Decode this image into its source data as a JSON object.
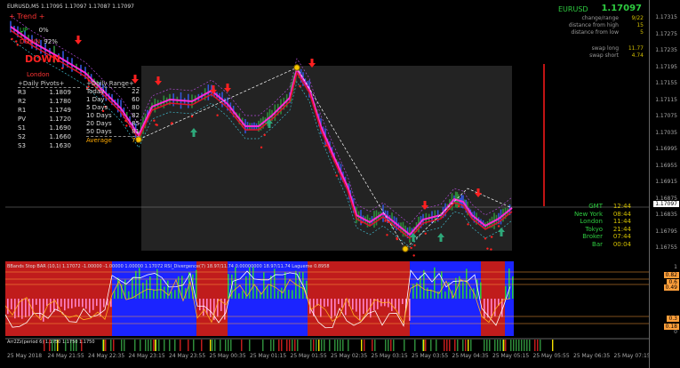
{
  "header": {
    "symbol_line": "EURUSD,M5  1.17095 1.17097 1.17087 1.17097"
  },
  "trend": {
    "title": "Trend",
    "up_label": "UP",
    "up_val": "0%",
    "down_label": "DOWN",
    "down_val": "92%",
    "direction": "DOWN",
    "session": "London"
  },
  "pivots": {
    "title": "+Daily Pivots+",
    "rows": [
      {
        "k": "R3",
        "v": "1.1809"
      },
      {
        "k": "R2",
        "v": "1.1780"
      },
      {
        "k": "R1",
        "v": "1.1749"
      },
      {
        "k": "PV",
        "v": "1.1720"
      },
      {
        "k": "S1",
        "v": "1.1690"
      },
      {
        "k": "S2",
        "v": "1.1660"
      },
      {
        "k": "S3",
        "v": "1.1630"
      }
    ]
  },
  "range": {
    "title": "+Daily Range+",
    "rows": [
      {
        "k": "Today",
        "v": "22"
      },
      {
        "k": "1 Day",
        "v": "60"
      },
      {
        "k": "5 Days",
        "v": "80"
      },
      {
        "k": "10 Days",
        "v": "82"
      },
      {
        "k": "20 Days",
        "v": "85"
      },
      {
        "k": "50 Days",
        "v": "81"
      },
      {
        "k": "Average",
        "v": "77"
      }
    ]
  },
  "info": {
    "symbol": "EURUSD",
    "price": "1.17097",
    "rows": [
      {
        "k": "change/range",
        "v": "9/22"
      },
      {
        "k": "distance from high",
        "v": "15"
      },
      {
        "k": "distance from low",
        "v": "5"
      },
      {
        "k": "swap long",
        "v": "11.77"
      },
      {
        "k": "swap short",
        "v": "4.74"
      }
    ]
  },
  "clocks": [
    {
      "k": "GMT",
      "v": "12:44"
    },
    {
      "k": "New York",
      "v": "08:44"
    },
    {
      "k": "London",
      "v": "11:44"
    },
    {
      "k": "Tokyo",
      "v": "21:44"
    },
    {
      "k": "Broker",
      "v": "07:44"
    },
    {
      "k": "Bar",
      "v": "00:04"
    }
  ],
  "osc_header": "BBands Stop BAR (10,1) 1.17072 -1.00000 -1.00000 1.00000 1.17072  RSI_Divergence(7) 18.97/11.74 0.00000000 18.97/11.74  Lagueme 0.8958",
  "band_header": "Arr2Zz(period 6) 1.1750 1.1750 1.1750",
  "price_axis": [
    "1.17315",
    "1.17275",
    "1.17235",
    "1.17195",
    "1.17155",
    "1.17115",
    "1.17075",
    "1.17035",
    "1.16995",
    "1.16955",
    "1.16915",
    "1.16875",
    "1.16835",
    "1.16795",
    "1.16755"
  ],
  "price_badge": "1.17097",
  "osc_axis": {
    "top": "1",
    "bottom": "0",
    "marks": [
      "0.82",
      "0.6",
      "0.49",
      "0.3",
      "0.18"
    ]
  },
  "time_axis": [
    "25 May 2018",
    "24 May 21:55",
    "24 May 22:35",
    "24 May 23:15",
    "24 May 23:55",
    "25 May 00:35",
    "25 May 01:15",
    "25 May 01:55",
    "25 May 02:35",
    "25 May 03:15",
    "25 May 03:55",
    "25 May 04:35",
    "25 May 05:15",
    "25 May 05:55",
    "25 May 06:35",
    "25 May 07:15"
  ]
}
